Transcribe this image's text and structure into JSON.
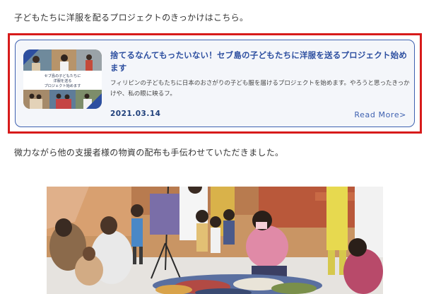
{
  "intro": {
    "text": "子どもたちに洋服を配るプロジェクトのきっかけはこちら。"
  },
  "card": {
    "title": "捨てるなんてもったいない！セブ島の子どもたちに洋服を送るプロジェクト始めます",
    "excerpt": "フィリピンの子どもたちに日本のおさがりの子ども服を届けるプロジェクトを始めます。やろうと思ったきっかけや、私の眼に映るフ。",
    "date": "2021.03.14",
    "read_more": "Read More>",
    "thumb_caption": [
      "セブ島の子どもたちに",
      "洋服を送る",
      "プロジェクト始めます"
    ]
  },
  "body": {
    "text": "微力ながら他の支援者様の物資の配布も手伝わせていただきました。"
  },
  "colors": {
    "highlight": "#d71b1b",
    "card_border": "#3e61b0",
    "title": "#2d4fa0",
    "date": "#1f3f7a"
  }
}
